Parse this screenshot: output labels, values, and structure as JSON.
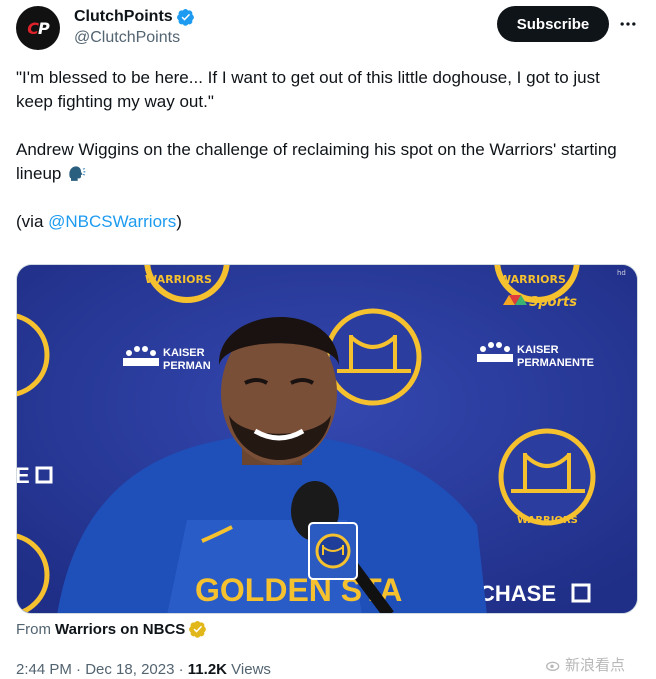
{
  "account": {
    "name": "ClutchPoints",
    "handle": "@ClutchPoints",
    "avatar_text": "CP",
    "verified_color": "#1d9bf0"
  },
  "actions": {
    "subscribe_label": "Subscribe",
    "more_label": "···"
  },
  "tweet": {
    "quote": "\"I'm blessed to be here... If I want to get out of this little doghouse, I got to just keep fighting my way out.\"",
    "context": "Andrew Wiggins on the challenge of reclaiming his spot on the Warriors' starting lineup ",
    "context_emoji": "speaking-head-icon",
    "via_prefix": "(via ",
    "via_mention": "@NBCSWarriors",
    "via_suffix": ")"
  },
  "media": {
    "broadcaster_logo": "Sports",
    "sponsor_text_1": "KAISER",
    "sponsor_text_2": "PERMANENTE",
    "sponsor_text_partial": "PERMAN",
    "bank_text": "CHASE",
    "bank_partial": "E",
    "team_arc_top": "GOLDEN STATE",
    "team_arc_bottom": "WARRIORS",
    "jersey_text": "GOLDEN STA",
    "corner_mark": "hd",
    "backdrop_color": "#2b3d9e",
    "accent_yellow": "#f5c12e"
  },
  "source": {
    "prefix": "From ",
    "name": "Warriors on NBCS",
    "badge_color": "#e2b719"
  },
  "meta": {
    "time": "2:44 PM",
    "sep": " · ",
    "date": "Dec 18, 2023",
    "views_count": "11.2K",
    "views_label": " Views"
  },
  "watermark": {
    "text": "新浪看点"
  }
}
